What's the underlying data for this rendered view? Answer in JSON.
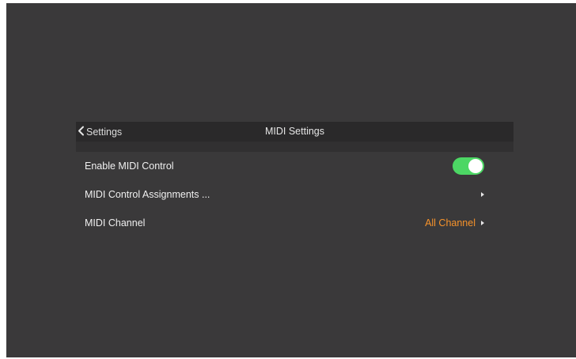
{
  "navbar": {
    "back_label": "Settings",
    "title": "MIDI Settings"
  },
  "rows": [
    {
      "label": "Enable MIDI Control",
      "toggle_on": true
    },
    {
      "label": "MIDI Control Assignments ..."
    },
    {
      "label": "MIDI Channel",
      "value": "All Channel"
    }
  ],
  "colors": {
    "background": "#3a393a",
    "navbar": "#2a292a",
    "toggle_on": "#4cd764",
    "value_accent": "#f7932b"
  },
  "icons": {
    "back": "chevron-left-icon",
    "disclosure": "chevron-right-icon"
  }
}
